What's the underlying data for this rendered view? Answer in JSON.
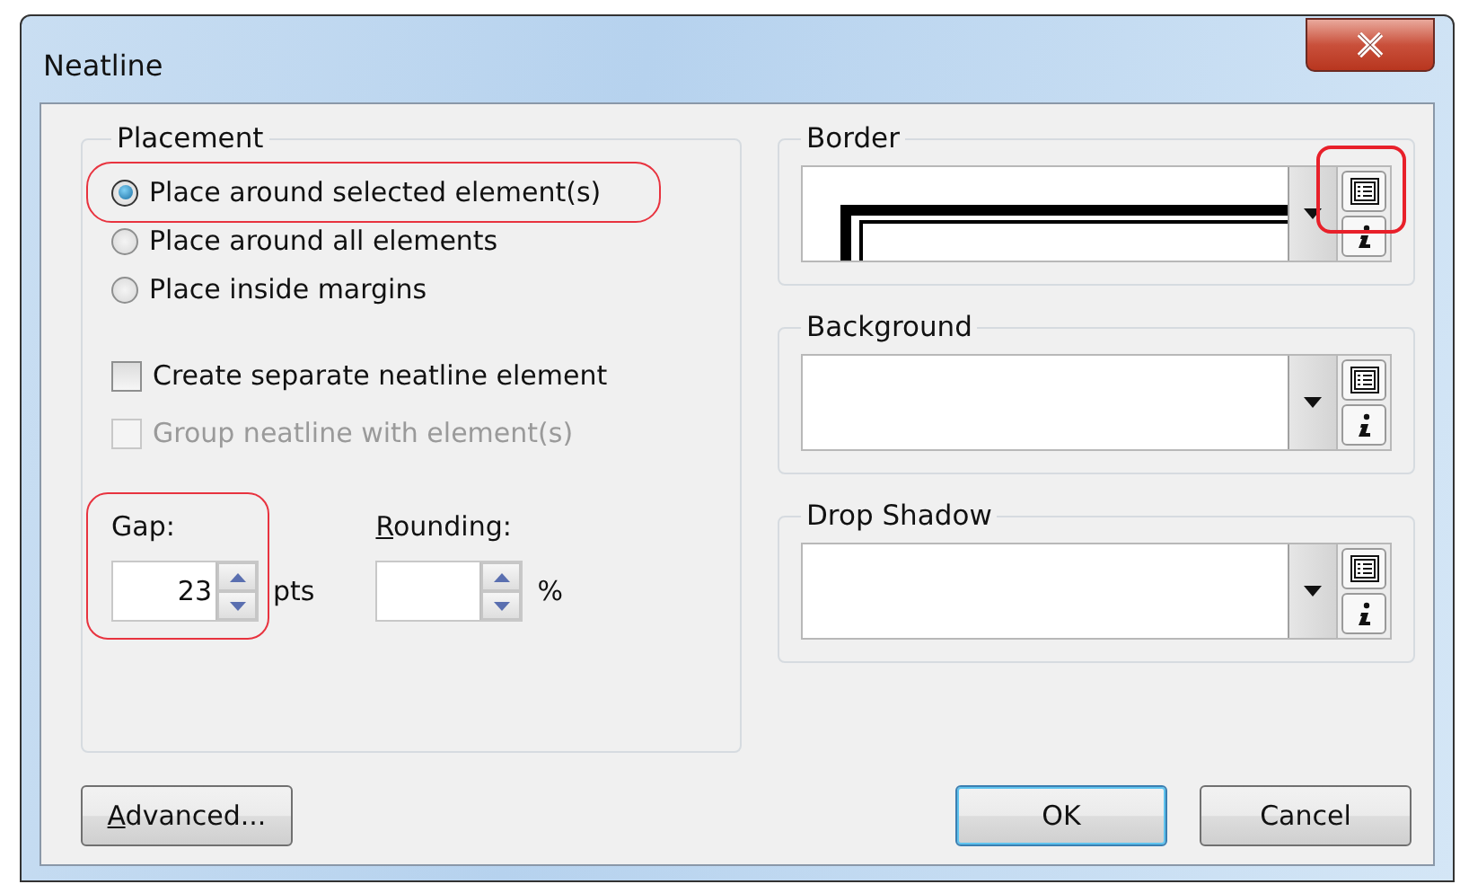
{
  "window": {
    "title": "Neatline"
  },
  "placement": {
    "title": "Placement",
    "options": [
      {
        "label": "Place around selected element(s)",
        "selected": true,
        "highlighted": true
      },
      {
        "label": "Place around all elements",
        "selected": false,
        "highlighted": false
      },
      {
        "label": "Place inside margins",
        "selected": false,
        "highlighted": false
      }
    ],
    "checkboxes": [
      {
        "label": "Create separate neatline element",
        "checked": false,
        "disabled": false
      },
      {
        "label": "Group neatline with element(s)",
        "checked": false,
        "disabled": true
      }
    ],
    "gap": {
      "label": "Gap:",
      "value": "23",
      "unit": "pts",
      "highlighted": true,
      "mnemonic": false
    },
    "rounding": {
      "label": "Rounding:",
      "unit": "%",
      "mnemonic": true
    }
  },
  "symbols": [
    {
      "title": "Border",
      "preview": true,
      "highlighted": true
    },
    {
      "title": "Background",
      "highlighted": false
    },
    {
      "title": "Drop Shadow",
      "highlighted": false
    }
  ],
  "buttons": [
    {
      "label": "Advanced...",
      "kind": "left",
      "mnemonic": true,
      "default": false
    },
    {
      "label": "OK",
      "kind": "right",
      "mnemonic": false,
      "default": true
    },
    {
      "label": "Cancel",
      "kind": "right",
      "mnemonic": false,
      "default": false
    }
  ]
}
